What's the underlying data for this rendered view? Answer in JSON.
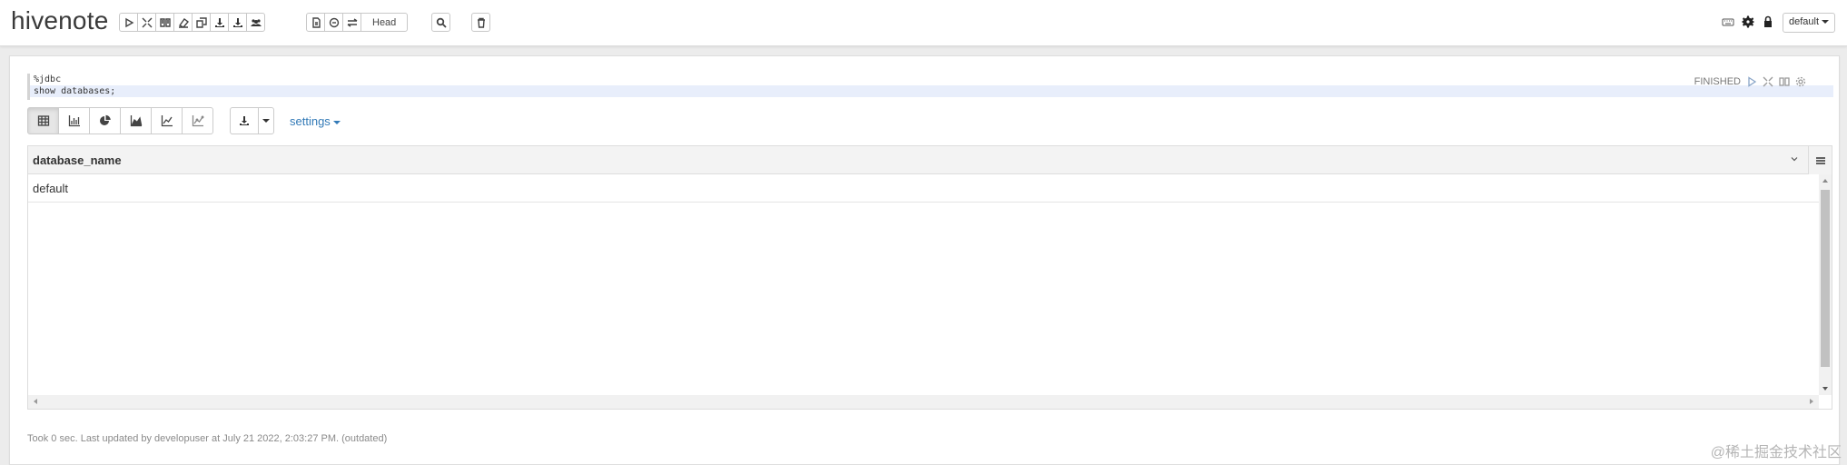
{
  "header": {
    "title": "hivenote",
    "head_label": "Head",
    "interpreter_label": "default"
  },
  "paragraph": {
    "code_lines": [
      "%jdbc",
      "show databases;"
    ],
    "status": "FINISHED",
    "settings_label": "settings",
    "table": {
      "columns": [
        "database_name"
      ],
      "rows": [
        [
          "default"
        ]
      ]
    },
    "footer": "Took 0 sec. Last updated by developuser at July 21 2022, 2:03:27 PM. (outdated)"
  },
  "watermark": "@稀土掘金技术社区"
}
